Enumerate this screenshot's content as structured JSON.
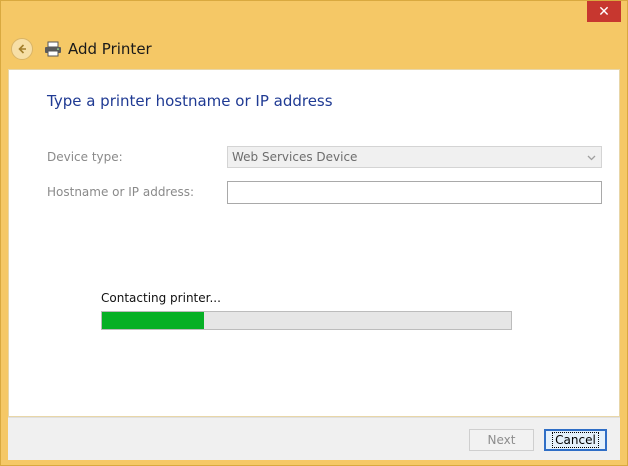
{
  "window": {
    "close_glyph": "✕"
  },
  "header": {
    "title": "Add Printer",
    "back_icon": "back-arrow-icon",
    "printer_icon": "printer-icon"
  },
  "page": {
    "heading": "Type a printer hostname or IP address"
  },
  "form": {
    "device_type_label": "Device type:",
    "device_type_value": "Web Services Device",
    "hostname_label": "Hostname or IP address:",
    "hostname_value": ""
  },
  "status": {
    "text": "Contacting printer...",
    "progress_percent": 25,
    "progress_color": "#06b025"
  },
  "footer": {
    "next_label": "Next",
    "cancel_label": "Cancel"
  },
  "colors": {
    "frame": "#f5c866",
    "title_text": "#1f3a93",
    "close_button": "#c7372f"
  }
}
